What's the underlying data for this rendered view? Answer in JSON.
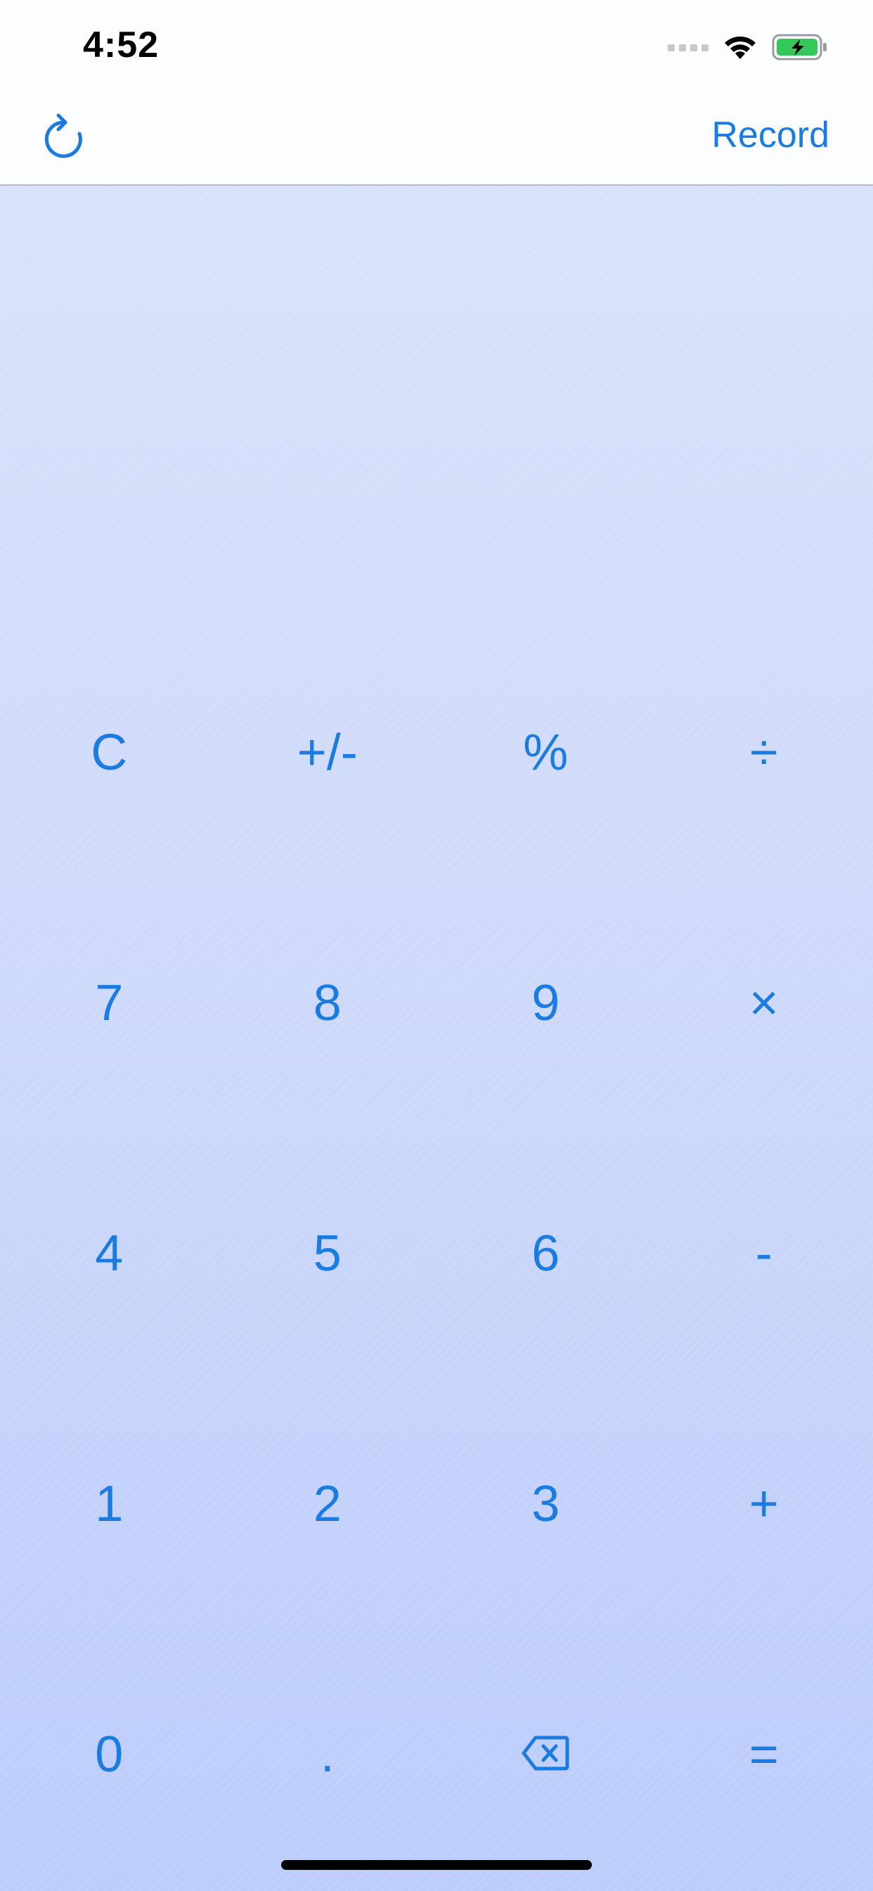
{
  "status_bar": {
    "time": "4:52",
    "icons": [
      "signal-dots-icon",
      "wifi-icon",
      "battery-charging-icon"
    ],
    "battery_color": "#34c759"
  },
  "nav": {
    "refresh_icon": "refresh-icon",
    "record_label": "Record"
  },
  "display": {
    "value": ""
  },
  "keypad": {
    "rows": [
      [
        {
          "name": "clear-key",
          "label": "C"
        },
        {
          "name": "sign-toggle-key",
          "label": "+/-"
        },
        {
          "name": "percent-key",
          "label": "%"
        },
        {
          "name": "divide-key",
          "label": "÷"
        }
      ],
      [
        {
          "name": "digit-7-key",
          "label": "7"
        },
        {
          "name": "digit-8-key",
          "label": "8"
        },
        {
          "name": "digit-9-key",
          "label": "9"
        },
        {
          "name": "multiply-key",
          "label": "×"
        }
      ],
      [
        {
          "name": "digit-4-key",
          "label": "4"
        },
        {
          "name": "digit-5-key",
          "label": "5"
        },
        {
          "name": "digit-6-key",
          "label": "6"
        },
        {
          "name": "subtract-key",
          "label": "-"
        }
      ],
      [
        {
          "name": "digit-1-key",
          "label": "1"
        },
        {
          "name": "digit-2-key",
          "label": "2"
        },
        {
          "name": "digit-3-key",
          "label": "3"
        },
        {
          "name": "add-key",
          "label": "+"
        }
      ],
      [
        {
          "name": "digit-0-key",
          "label": "0"
        },
        {
          "name": "decimal-key",
          "label": "."
        },
        {
          "name": "backspace-key",
          "label": "",
          "icon": "backspace-icon"
        },
        {
          "name": "equals-key",
          "label": "="
        }
      ]
    ]
  },
  "colors": {
    "accent": "#1a7be0",
    "background_top": "#d8e2fb",
    "background_bottom": "#bccdfb"
  }
}
